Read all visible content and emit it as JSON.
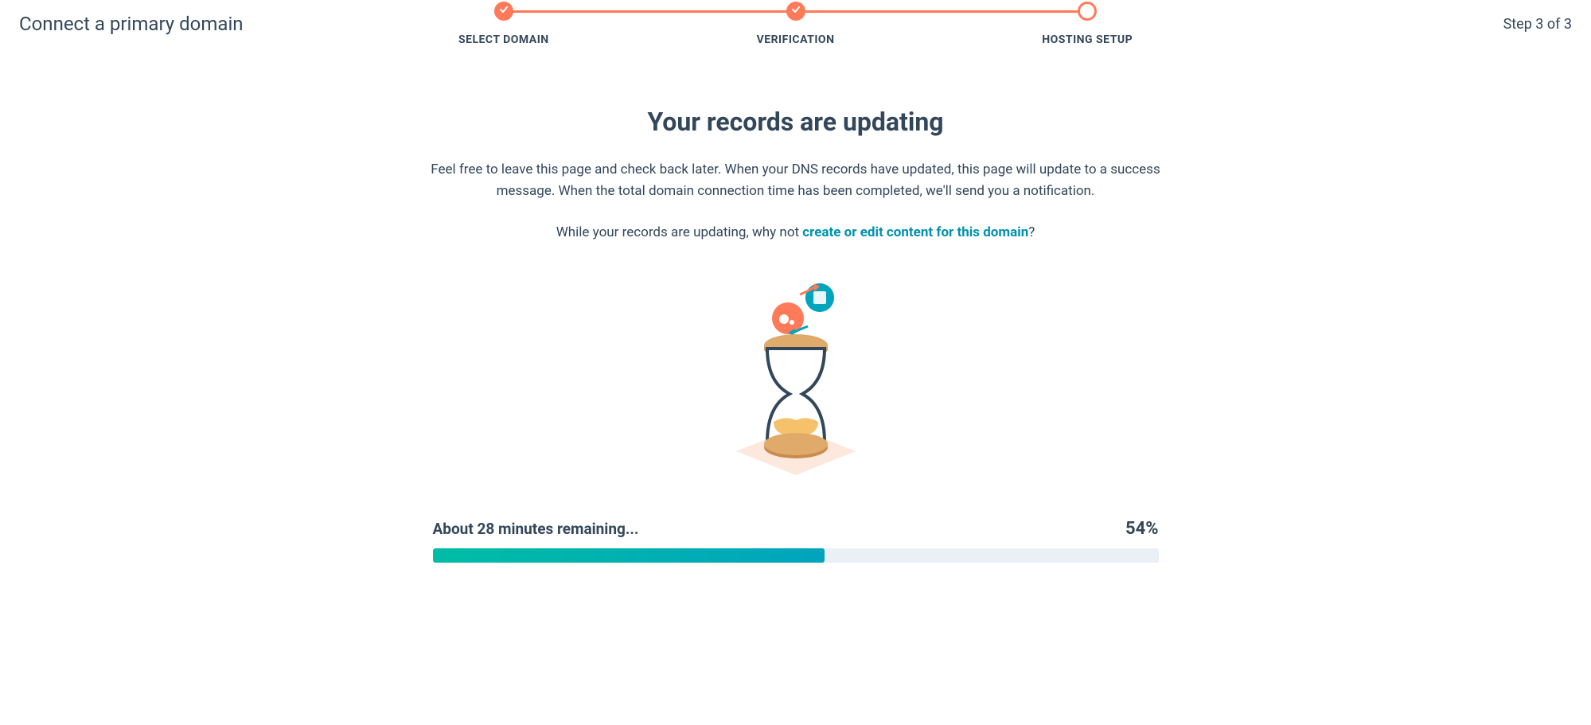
{
  "header": {
    "title": "Connect a primary domain",
    "step_indicator": "Step 3 of 3"
  },
  "stepper": {
    "steps": [
      {
        "label": "SELECT DOMAIN",
        "state": "completed"
      },
      {
        "label": "VERIFICATION",
        "state": "completed"
      },
      {
        "label": "HOSTING SETUP",
        "state": "current"
      }
    ]
  },
  "main": {
    "title": "Your records are updating",
    "description": "Feel free to leave this page and check back later. When your DNS records have updated, this page will update to a success message. When the total domain connection time has been completed, we'll send you a notification.",
    "prompt_prefix": "While your records are updating, why not ",
    "link_text": "create or edit content for this domain",
    "prompt_suffix": "?"
  },
  "progress": {
    "time_remaining": "About 28 minutes remaining...",
    "percent": "54%",
    "percent_value": 54
  }
}
